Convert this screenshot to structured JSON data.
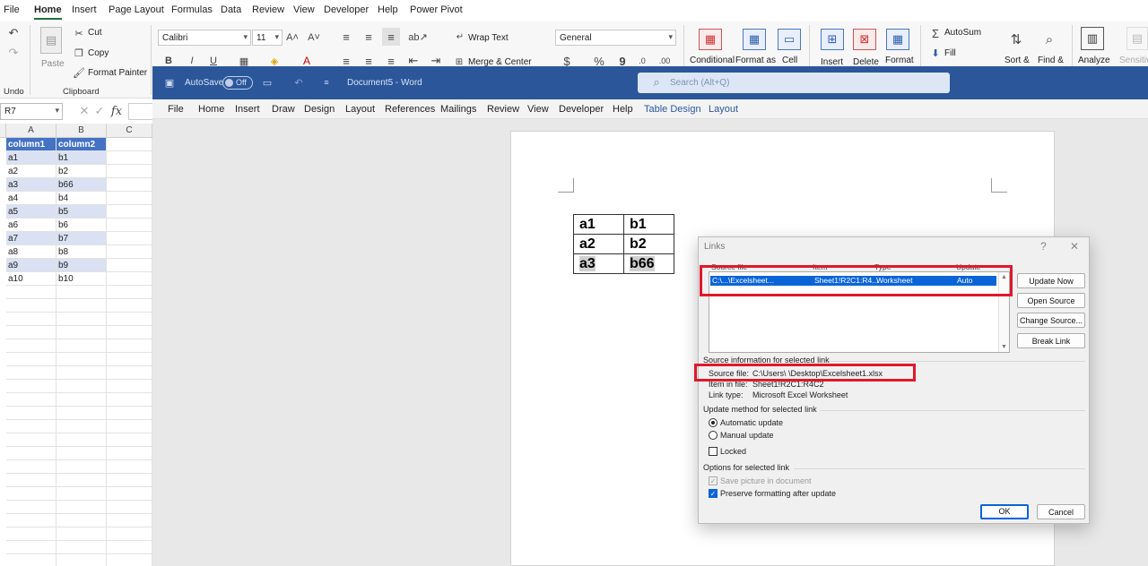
{
  "excel": {
    "menu": [
      "File",
      "Home",
      "Insert",
      "Page Layout",
      "Formulas",
      "Data",
      "Review",
      "View",
      "Developer",
      "Help",
      "Power Pivot"
    ],
    "active_menu": "Home",
    "ribbon": {
      "paste": "Paste",
      "cut": "Cut",
      "copy": "Copy",
      "format_painter": "Format Painter",
      "undo_group": "Undo",
      "clipboard_group": "Clipboard",
      "font": "Calibri",
      "size": "11",
      "wrap_text": "Wrap Text",
      "merge_center": "Merge & Center",
      "number_format": "General",
      "conditional": "Conditional",
      "format_as": "Format as",
      "cell": "Cell",
      "insert": "Insert",
      "delete": "Delete",
      "format": "Format",
      "autosum": "AutoSum",
      "fill": "Fill",
      "sort": "Sort &",
      "find": "Find &",
      "analyze": "Analyze",
      "sensitivity": "Sensitivi"
    },
    "name_box": "R7",
    "fx": "fx",
    "columns": [
      "A",
      "B",
      "C"
    ],
    "table_headers": [
      "column1",
      "column2"
    ],
    "rows": [
      [
        "a1",
        "b1"
      ],
      [
        "a2",
        "b2"
      ],
      [
        "a3",
        "b66"
      ],
      [
        "a4",
        "b4"
      ],
      [
        "a5",
        "b5"
      ],
      [
        "a6",
        "b6"
      ],
      [
        "a7",
        "b7"
      ],
      [
        "a8",
        "b8"
      ],
      [
        "a9",
        "b9"
      ],
      [
        "a10",
        "b10"
      ]
    ]
  },
  "word": {
    "autosave": "AutoSave",
    "autosave_state": "Off",
    "doc_title": "Document5  -  Word",
    "search_placeholder": "Search (Alt+Q)",
    "menu": [
      "File",
      "Home",
      "Insert",
      "Draw",
      "Design",
      "Layout",
      "References",
      "Mailings",
      "Review",
      "View",
      "Developer",
      "Help",
      "Table Design",
      "Layout"
    ],
    "doc_table": [
      [
        "a1",
        "b1"
      ],
      [
        "a2",
        "b2"
      ],
      [
        "a3",
        "b66"
      ]
    ]
  },
  "dialog": {
    "title": "Links",
    "help": "?",
    "close": "✕",
    "col_source": "Source file",
    "col_item": "Item",
    "col_type": "Type",
    "col_update": "Update",
    "row": {
      "source": "C:\\...\\Excelsheet...",
      "item": "Sheet1!R2C1:R4...",
      "type": "Worksheet",
      "update": "Auto"
    },
    "buttons": {
      "update_now": "Update Now",
      "open_source": "Open Source",
      "change_source": "Change Source...",
      "break_link": "Break Link",
      "ok": "OK",
      "cancel": "Cancel"
    },
    "source_info_heading": "Source information for selected link",
    "source_file_label": "Source file:",
    "source_file_value": "C:\\Users\\       \\Desktop\\Excelsheet1.xlsx",
    "item_label": "Item in file:",
    "item_value": "Sheet1!R2C1:R4C2",
    "link_type_label": "Link type:",
    "link_type_value": "Microsoft Excel Worksheet",
    "update_method_heading": "Update method for selected link",
    "automatic": "Automatic update",
    "manual": "Manual update",
    "locked": "Locked",
    "options_heading": "Options for selected link",
    "save_picture": "Save picture in document",
    "preserve": "Preserve formatting after update"
  },
  "colors": {
    "word_blue": "#2b579a",
    "excel_green": "#1e6e3a",
    "table_header": "#4472c4",
    "table_band": "#d9e1f2",
    "selection": "#0a64d8",
    "annotation_red": "#e0182b"
  }
}
